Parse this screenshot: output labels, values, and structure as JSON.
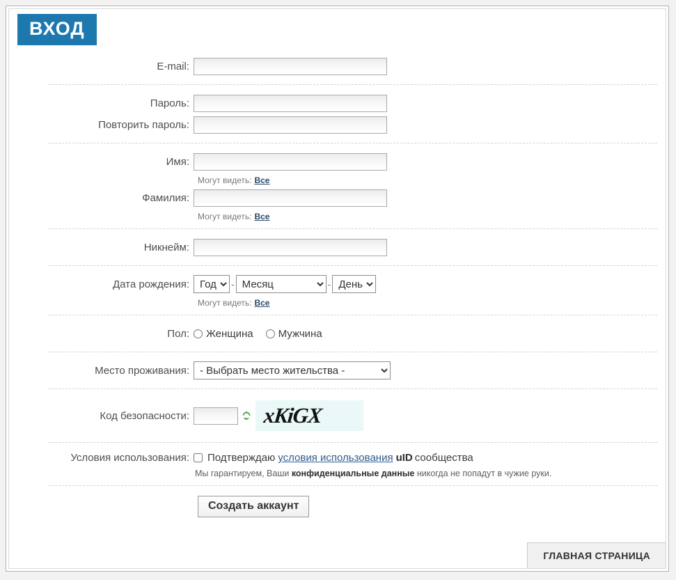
{
  "header": {
    "badge": "ВХОД"
  },
  "labels": {
    "email": "E-mail:",
    "password": "Пароль:",
    "password_repeat": "Повторить пароль:",
    "first_name": "Имя:",
    "last_name": "Фамилия:",
    "nickname": "Никнейм:",
    "birthdate": "Дата рождения:",
    "gender": "Пол:",
    "location": "Место проживания:",
    "security_code": "Код безопасности:",
    "terms": "Условия использования:"
  },
  "values": {
    "email": "",
    "password": "",
    "password_repeat": "",
    "first_name": "",
    "last_name": "",
    "nickname": "",
    "security_code": ""
  },
  "visibility_note": {
    "prefix": "Могут видеть:",
    "link": "Все"
  },
  "birthdate": {
    "year_selected": "Год",
    "month_selected": "Месяц",
    "day_selected": "День",
    "separator": "-"
  },
  "gender_options": [
    {
      "label": "Женщина",
      "value": "female",
      "checked": false
    },
    {
      "label": "Мужчина",
      "value": "male",
      "checked": false
    }
  ],
  "location": {
    "selected": "- Выбрать место жительства -"
  },
  "captcha": {
    "text": "xKiGX",
    "refresh_icon": "refresh-icon",
    "background": "#eaf8f8"
  },
  "terms": {
    "checkbox_checked": false,
    "line_part1": "Подтверждаю",
    "link_text": "условия использования",
    "brand": "uID",
    "line_part2": "сообщества",
    "note_part1": "Мы гарантируем, Ваши",
    "note_bold": "конфиденциальные данные",
    "note_part2": "никогда не попадут в чужие руки."
  },
  "submit": {
    "label": "Создать аккаунт"
  },
  "footer": {
    "tab_label": "ГЛАВНАЯ СТРАНИЦА"
  },
  "colors": {
    "badge_blue": "#1d78ae",
    "link_blue": "#2f5c8f",
    "note_link": "#2b4a6b",
    "captcha_bg": "#eaf8f8",
    "refresh_green": "#3a9a3a"
  }
}
